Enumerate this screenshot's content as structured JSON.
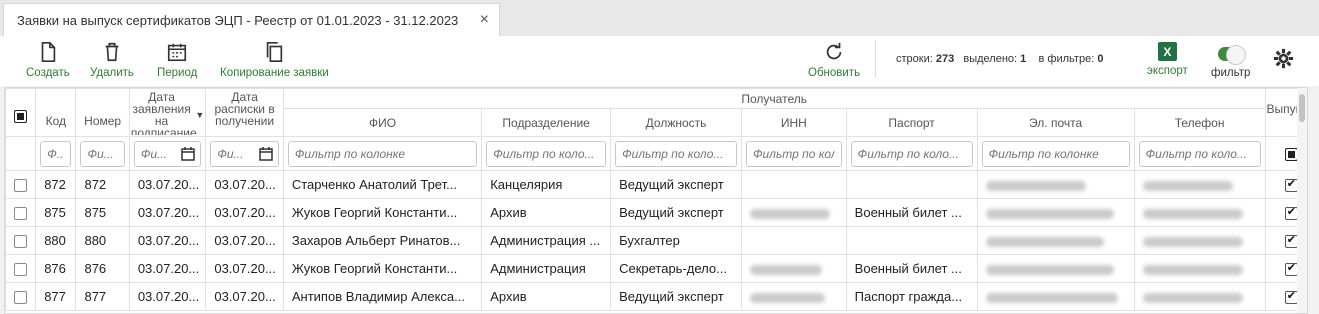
{
  "tab": {
    "title": "Заявки на выпуск сертификатов ЭЦП - Реестр от 01.01.2023 - 31.12.2023",
    "close_icon": "×"
  },
  "toolbar": {
    "create": "Создать",
    "delete": "Удалить",
    "period": "Период",
    "copy": "Копирование заявки",
    "refresh": "Обновить",
    "export": "экспорт",
    "filter": "фильтр"
  },
  "stats": {
    "rows_label": "строки:",
    "rows_value": "273",
    "selected_label": "выделено:",
    "selected_value": "1",
    "filter_label": "в фильтре:",
    "filter_value": "0"
  },
  "excel": {
    "letter": "X"
  },
  "grid": {
    "group_header": "Получатель",
    "headers": {
      "kod": "Код",
      "nomer": "Номер",
      "date_request": "Дата заявления на подписание",
      "date_receipt": "Дата расписки в получении",
      "fio": "ФИО",
      "division": "Подразделение",
      "position": "Должность",
      "inn": "ИНН",
      "passport": "Паспорт",
      "email": "Эл. почта",
      "phone": "Телефон",
      "issued": "Выпущен"
    },
    "filters": {
      "kod": "Ф...",
      "nomer": "Фи...",
      "date1": "Фи...",
      "date2": "Фи...",
      "fio": "Фильтр по колонке",
      "division": "Фильтр по коло...",
      "position": "Фильтр по коло...",
      "inn": "Фильтр по коло...",
      "passport": "Фильтр по коло...",
      "email": "Фильтр по колонке",
      "phone": "Фильтр по коло..."
    },
    "rows": [
      {
        "kod": "872",
        "nomer": "872",
        "d1": "03.07.20...",
        "d2": "03.07.20...",
        "fio": "Старченко Анатолий Трет...",
        "division": "Канцелярия",
        "position": "Ведущий эксперт",
        "passport": ""
      },
      {
        "kod": "875",
        "nomer": "875",
        "d1": "03.07.20...",
        "d2": "03.07.20...",
        "fio": "Жуков Георгий Константи...",
        "division": "Архив",
        "position": "Ведущий эксперт",
        "passport": "Военный билет ..."
      },
      {
        "kod": "880",
        "nomer": "880",
        "d1": "03.07.20...",
        "d2": "03.07.20...",
        "fio": "Захаров Альберт Ринатов...",
        "division": "Администрация ...",
        "position": "Бухгалтер",
        "passport": ""
      },
      {
        "kod": "876",
        "nomer": "876",
        "d1": "03.07.20...",
        "d2": "03.07.20...",
        "fio": "Жуков Георгий Константи...",
        "division": "Администрация",
        "position": "Секретарь-дело...",
        "passport": "Военный билет ..."
      },
      {
        "kod": "877",
        "nomer": "877",
        "d1": "03.07.20...",
        "d2": "03.07.20...",
        "fio": "Антипов Владимир Алекса...",
        "division": "Архив",
        "position": "Ведущий эксперт",
        "passport": "Паспорт гражда..."
      }
    ]
  },
  "colors": {
    "accent_green": "#2e7d32",
    "excel_green": "#217346"
  }
}
